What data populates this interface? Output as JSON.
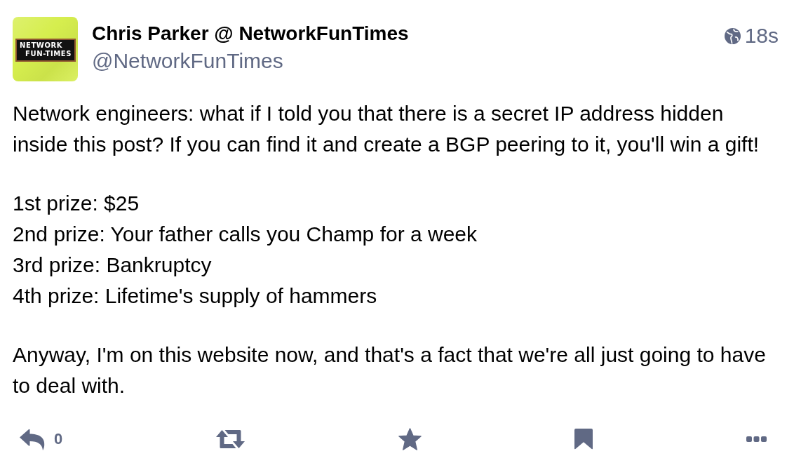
{
  "author": {
    "avatar": {
      "logo_lines": [
        "NETWORK",
        "FUN-TIMES"
      ]
    },
    "display_name": "Chris Parker @ NetworkFunTimes",
    "handle": "@NetworkFunTimes"
  },
  "meta": {
    "public": true,
    "time": "18s"
  },
  "content": {
    "paragraphs": [
      [
        "Network engineers: what if I told you that there is a secret IP address hidden inside this post? If you can find it and create a BGP peering to it, you'll win a gift!"
      ],
      [
        "1st prize: $25",
        "2nd prize: Your father calls you Champ for a week",
        "3rd prize: Bankruptcy",
        "4th prize: Lifetime's supply of hammers"
      ],
      [
        "Anyway, I'm on this website now, and that's a fact that we're all just going to have to deal with."
      ]
    ]
  },
  "actions": [
    {
      "kind": "reply",
      "count": "0"
    },
    {
      "kind": "boost"
    },
    {
      "kind": "favourite"
    },
    {
      "kind": "bookmark"
    },
    {
      "kind": "more"
    }
  ]
}
